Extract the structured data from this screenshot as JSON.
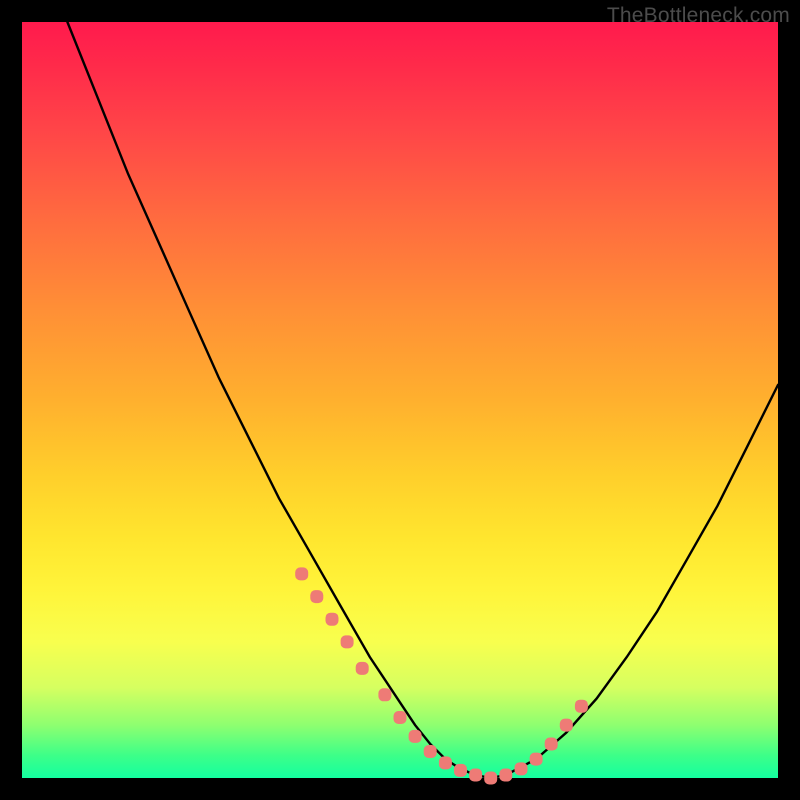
{
  "watermark": "TheBottleneck.com",
  "colors": {
    "frame": "#000000",
    "curve_stroke": "#000000",
    "marker_fill": "#ee7b76",
    "gradient_top": "#ff1a4d",
    "gradient_bottom": "#14ffa0"
  },
  "chart_data": {
    "type": "line",
    "title": "",
    "xlabel": "",
    "ylabel": "",
    "xlim": [
      0,
      100
    ],
    "ylim": [
      0,
      100
    ],
    "grid": false,
    "legend": false,
    "annotations": [
      "TheBottleneck.com"
    ],
    "series": [
      {
        "name": "curve",
        "x": [
          6,
          10,
          14,
          18,
          22,
          26,
          30,
          34,
          38,
          42,
          46,
          50,
          52,
          54,
          56,
          58,
          60,
          62,
          64,
          68,
          72,
          76,
          80,
          84,
          88,
          92,
          96,
          100
        ],
        "y": [
          100,
          90,
          80,
          71,
          62,
          53,
          45,
          37,
          30,
          23,
          16,
          10,
          7,
          4.5,
          2.5,
          1.2,
          0.4,
          0,
          0.4,
          2.5,
          6,
          10.5,
          16,
          22,
          29,
          36,
          44,
          52
        ]
      },
      {
        "name": "markers",
        "x": [
          37,
          39,
          41,
          43,
          45,
          48,
          50,
          52,
          54,
          56,
          58,
          60,
          62,
          64,
          66,
          68,
          70,
          72,
          74
        ],
        "y": [
          27,
          24,
          21,
          18,
          14.5,
          11,
          8,
          5.5,
          3.5,
          2,
          1,
          0.4,
          0,
          0.4,
          1.2,
          2.5,
          4.5,
          7,
          9.5
        ]
      }
    ]
  }
}
